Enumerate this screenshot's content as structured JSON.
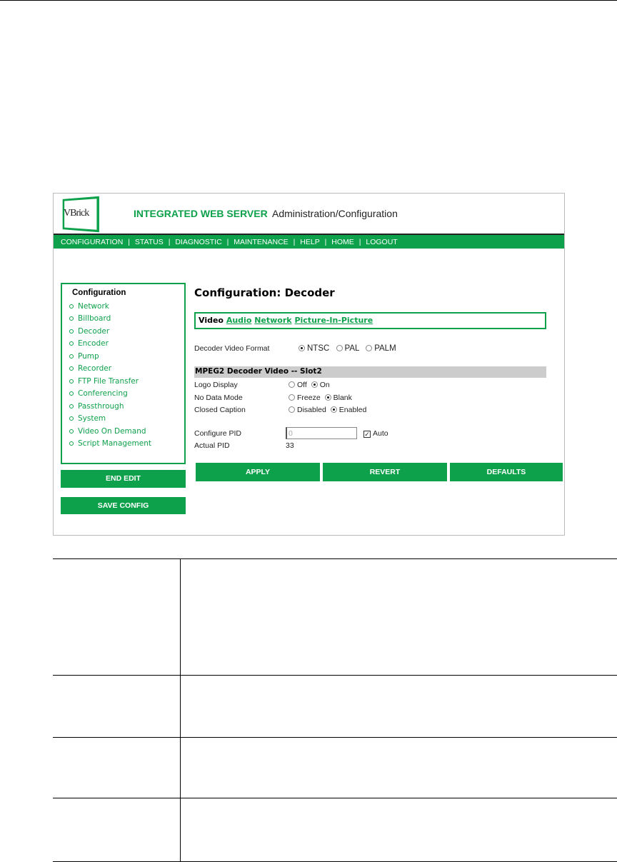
{
  "header": {
    "logo_text": "VBrick",
    "title": "INTEGRATED WEB SERVER",
    "subtitle": "Administration/Configuration"
  },
  "nav": [
    "CONFIGURATION",
    "|",
    "STATUS",
    "|",
    "DIAGNOSTIC",
    "|",
    "MAINTENANCE",
    "|",
    "HELP",
    "|",
    "HOME",
    "|",
    "LOGOUT"
  ],
  "sidebar": {
    "heading": "Configuration",
    "items": [
      "Network",
      "Billboard",
      "Decoder",
      "Encoder",
      "Pump",
      "Recorder",
      "FTP File Transfer",
      "Conferencing",
      "Passthrough",
      "System",
      "Video On Demand",
      "Script Management"
    ],
    "end_edit": "END EDIT",
    "save_config": "SAVE CONFIG"
  },
  "main": {
    "heading": "Configuration: Decoder",
    "tabs": {
      "current": "Video",
      "links": [
        "Audio",
        "Network",
        "Picture-In-Picture"
      ]
    },
    "format": {
      "label": "Decoder Video Format",
      "options": [
        "NTSC",
        "PAL",
        "PALM"
      ],
      "selected": "NTSC"
    },
    "section": "MPEG2 Decoder Video -- Slot2",
    "logo_display": {
      "label": "Logo Display",
      "options": [
        "Off",
        "On"
      ],
      "selected": "On"
    },
    "no_data_mode": {
      "label": "No Data Mode",
      "options": [
        "Freeze",
        "Blank"
      ],
      "selected": "Blank"
    },
    "closed_caption": {
      "label": "Closed Caption",
      "options": [
        "Disabled",
        "Enabled"
      ],
      "selected": "Enabled"
    },
    "pid": {
      "label": "Configure PID",
      "value": "0",
      "auto_label": "Auto",
      "auto_checked": true
    },
    "actual_pid": {
      "label": "Actual PID",
      "value": "33"
    },
    "buttons": {
      "apply": "APPLY",
      "revert": "REVERT",
      "defaults": "DEFAULTS"
    }
  },
  "colors": {
    "brand": "#0ea14b",
    "section_gray": "#cccccc"
  }
}
